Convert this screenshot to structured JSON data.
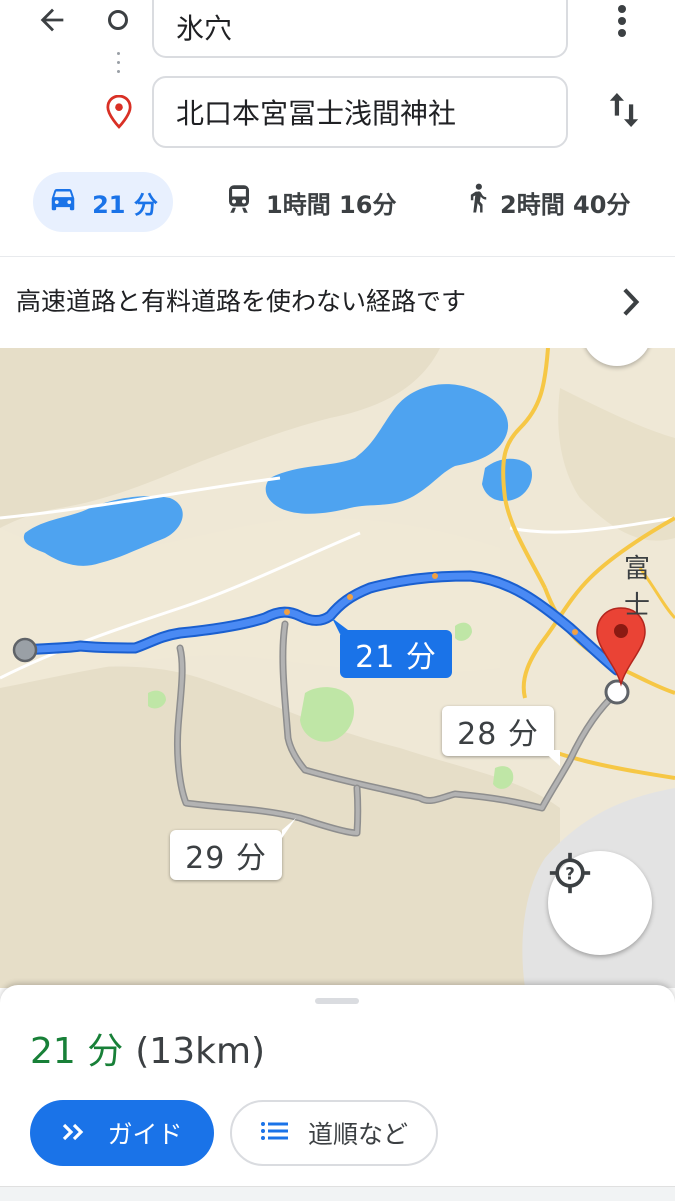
{
  "header": {
    "origin_value": "氷穴",
    "destination_value": "北口本宮冨士浅間神社",
    "icons": {
      "back": "arrow-back-icon",
      "origin": "origin-circle-icon",
      "destination": "destination-pin-icon",
      "menu": "more-vert-icon",
      "swap": "swap-vert-icon"
    }
  },
  "modes": {
    "drive": {
      "label": "21 分",
      "icon": "car-icon",
      "selected": true
    },
    "transit": {
      "label": "1時間 16分",
      "icon": "train-icon"
    },
    "walk": {
      "label": "2時間 40分",
      "icon": "walk-icon"
    }
  },
  "notice": {
    "text": "高速道路と有料道路を使わない経路です",
    "icon": "chevron-right-icon"
  },
  "map": {
    "route_times": {
      "main": "21 分",
      "alt1": "28 分",
      "alt2": "29 分"
    },
    "place_label": "富士",
    "colors": {
      "route": "#4285f4",
      "route_border": "#1a5fcf",
      "alt_route": "#9e9e9e",
      "land": "#efe8d6",
      "hills": "#e4dcc4",
      "water": "#4ea3f0",
      "park": "#bfe6a6",
      "road": "#f6c745",
      "urban": "#e8e8e8"
    },
    "locate_icon": "my-location-icon"
  },
  "sheet": {
    "duration": "21 分",
    "distance": "(13km)",
    "guide_label": "ガイド",
    "guide_icon": "navigation-chevrons-icon",
    "steps_label": "道順など",
    "steps_icon": "list-icon"
  }
}
